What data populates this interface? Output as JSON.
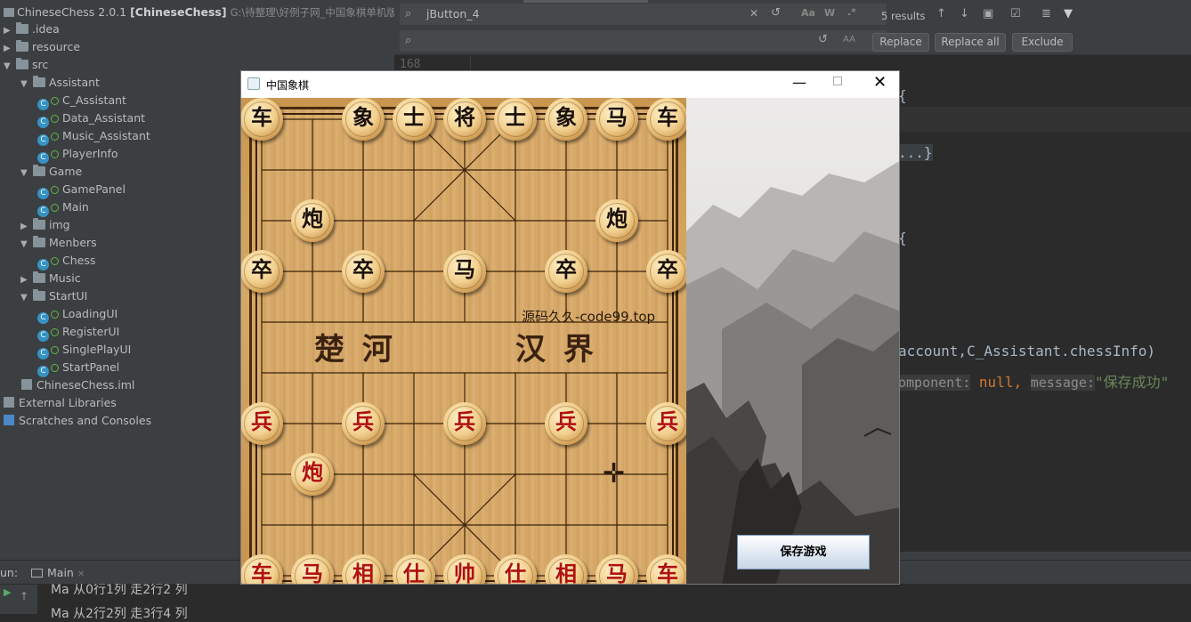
{
  "ide": {
    "project_title": "ChineseChess 2.0.1",
    "project_module": "[ChineseChess]",
    "project_path": "G:\\待整理\\好例子网_中国象棋单机版-ᶠ",
    "tree": [
      {
        "label": ".idea",
        "type": "folder",
        "expanded": false,
        "indent": 0
      },
      {
        "label": "resource",
        "type": "folder",
        "expanded": false,
        "indent": 0
      },
      {
        "label": "src",
        "type": "folder",
        "expanded": true,
        "indent": 0
      },
      {
        "label": "Assistant",
        "type": "folder",
        "expanded": true,
        "indent": 1
      },
      {
        "label": "C_Assistant",
        "type": "class",
        "indent": 2
      },
      {
        "label": "Data_Assistant",
        "type": "class",
        "indent": 2
      },
      {
        "label": "Music_Assistant",
        "type": "class",
        "indent": 2
      },
      {
        "label": "PlayerInfo",
        "type": "class",
        "indent": 2
      },
      {
        "label": "Game",
        "type": "folder",
        "expanded": true,
        "indent": 1
      },
      {
        "label": "GamePanel",
        "type": "class",
        "indent": 2
      },
      {
        "label": "Main",
        "type": "class",
        "indent": 2
      },
      {
        "label": "img",
        "type": "folder",
        "expanded": false,
        "indent": 1
      },
      {
        "label": "Menbers",
        "type": "folder",
        "expanded": true,
        "indent": 1
      },
      {
        "label": "Chess",
        "type": "class",
        "indent": 2
      },
      {
        "label": "Music",
        "type": "folder",
        "expanded": false,
        "indent": 1
      },
      {
        "label": "StartUI",
        "type": "folder",
        "expanded": true,
        "indent": 1
      },
      {
        "label": "LoadingUI",
        "type": "class",
        "indent": 2
      },
      {
        "label": "RegisterUI",
        "type": "class",
        "indent": 2
      },
      {
        "label": "SinglePlayUI",
        "type": "class",
        "indent": 2
      },
      {
        "label": "StartPanel",
        "type": "class",
        "indent": 2
      },
      {
        "label": "ChineseChess.iml",
        "type": "file",
        "indent": 0
      },
      {
        "label": "External Libraries",
        "type": "lib",
        "indent": -1
      },
      {
        "label": "Scratches and Consoles",
        "type": "scratch",
        "indent": -1
      }
    ],
    "find": {
      "query": "jButton_4",
      "replace_value": "",
      "results": "5 results",
      "replace_label": "Replace",
      "replace_all_label": "Replace all",
      "exclude_label": "Exclude",
      "toggle_case": "Aa",
      "toggle_word": "W",
      "toggle_regex": ".*",
      "toggle_preserve": "AA"
    },
    "code": {
      "line_number": "168",
      "brace1": "{",
      "fold": "...}",
      "brace2": "{",
      "line_call": "account,C_Assistant.chessInfo)",
      "hint_component": "omponent:",
      "null_kw": "null,",
      "hint_message": "message:",
      "msg_string": "\"保存成功\""
    },
    "run": {
      "label": "un:",
      "tab": "Main",
      "out1": "Ma   从0行1列      走2行2 列",
      "out2": "Ma   从2行2列      走3行4 列"
    }
  },
  "game": {
    "window_title": "中国象棋",
    "river_left": "楚 河",
    "river_right": "汉 界",
    "watermark": "源码久久-code99.top",
    "save_button": "保存游戏",
    "pieces": [
      {
        "char": "车",
        "side": "black",
        "col": 0,
        "row": 0
      },
      {
        "char": "象",
        "side": "black",
        "col": 2,
        "row": 0
      },
      {
        "char": "士",
        "side": "black",
        "col": 3,
        "row": 0
      },
      {
        "char": "将",
        "side": "black",
        "col": 4,
        "row": 0
      },
      {
        "char": "士",
        "side": "black",
        "col": 5,
        "row": 0
      },
      {
        "char": "象",
        "side": "black",
        "col": 6,
        "row": 0
      },
      {
        "char": "马",
        "side": "black",
        "col": 7,
        "row": 0
      },
      {
        "char": "车",
        "side": "black",
        "col": 8,
        "row": 0
      },
      {
        "char": "炮",
        "side": "black",
        "col": 1,
        "row": 2
      },
      {
        "char": "炮",
        "side": "black",
        "col": 7,
        "row": 2
      },
      {
        "char": "卒",
        "side": "black",
        "col": 0,
        "row": 3
      },
      {
        "char": "卒",
        "side": "black",
        "col": 2,
        "row": 3
      },
      {
        "char": "马",
        "side": "black",
        "col": 4,
        "row": 3
      },
      {
        "char": "卒",
        "side": "black",
        "col": 6,
        "row": 3
      },
      {
        "char": "卒",
        "side": "black",
        "col": 8,
        "row": 3
      },
      {
        "char": "兵",
        "side": "red",
        "col": 0,
        "row": 6
      },
      {
        "char": "兵",
        "side": "red",
        "col": 2,
        "row": 6
      },
      {
        "char": "兵",
        "side": "red",
        "col": 4,
        "row": 6
      },
      {
        "char": "兵",
        "side": "red",
        "col": 6,
        "row": 6
      },
      {
        "char": "兵",
        "side": "red",
        "col": 8,
        "row": 6
      },
      {
        "char": "炮",
        "side": "red",
        "col": 1,
        "row": 7
      },
      {
        "char": "车",
        "side": "red",
        "col": 0,
        "row": 9
      },
      {
        "char": "马",
        "side": "red",
        "col": 1,
        "row": 9
      },
      {
        "char": "相",
        "side": "red",
        "col": 2,
        "row": 9
      },
      {
        "char": "仕",
        "side": "red",
        "col": 3,
        "row": 9
      },
      {
        "char": "帅",
        "side": "red",
        "col": 4,
        "row": 9
      },
      {
        "char": "仕",
        "side": "red",
        "col": 5,
        "row": 9
      },
      {
        "char": "相",
        "side": "red",
        "col": 6,
        "row": 9
      },
      {
        "char": "马",
        "side": "red",
        "col": 7,
        "row": 9
      },
      {
        "char": "车",
        "side": "red",
        "col": 8,
        "row": 9
      }
    ]
  }
}
